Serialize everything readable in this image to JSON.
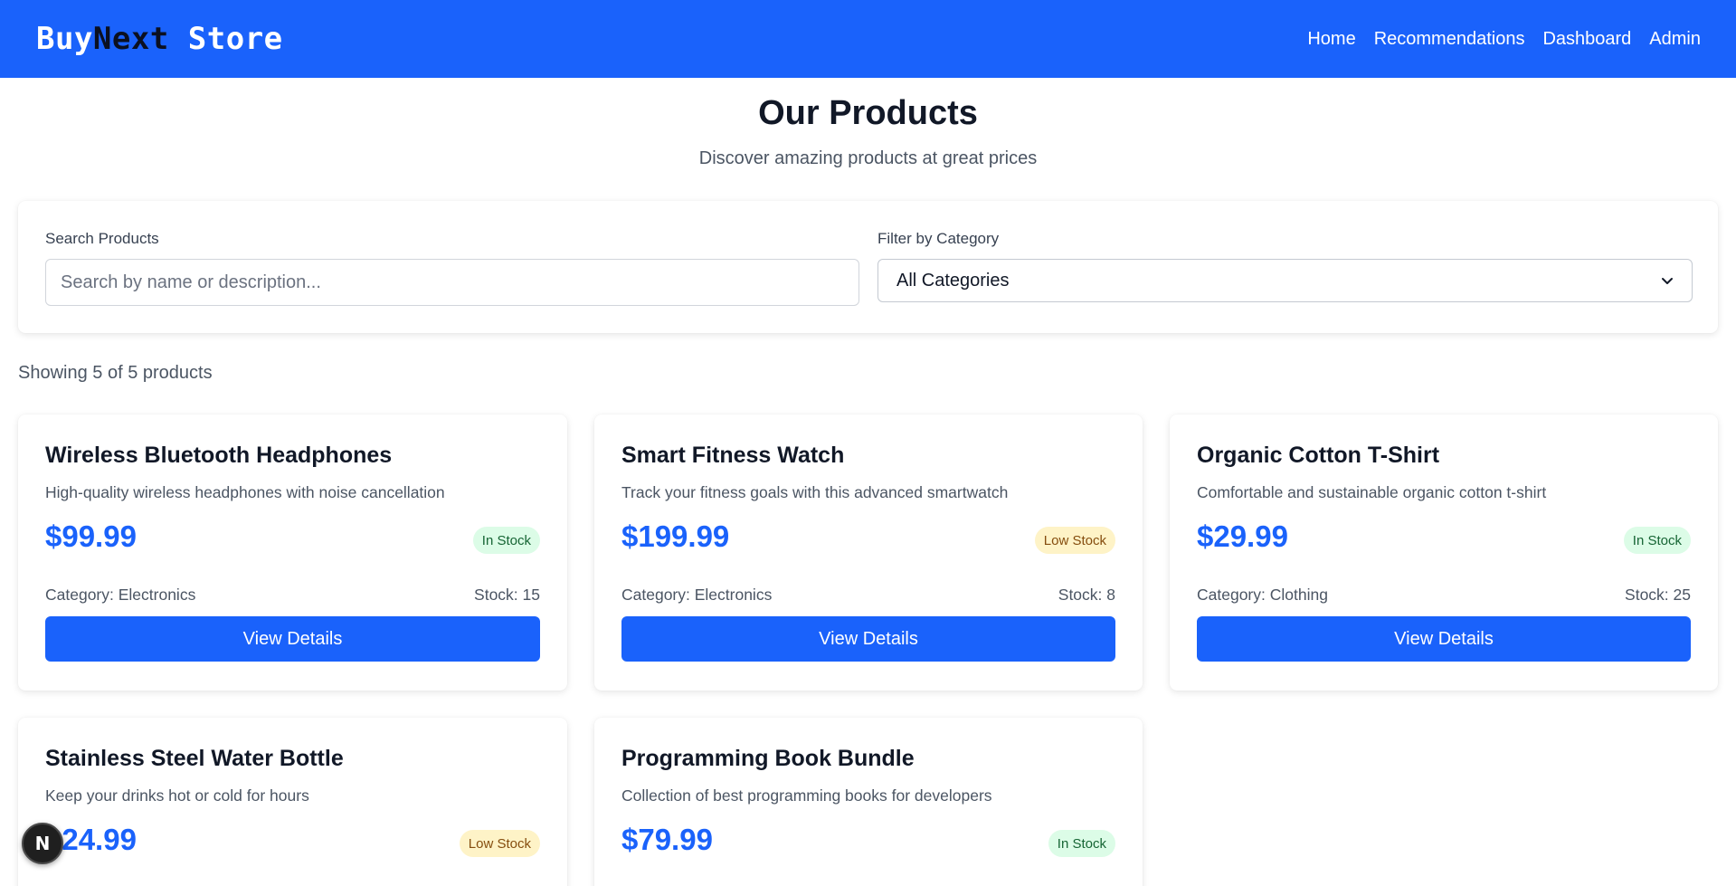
{
  "header": {
    "brand_part1": "Buy",
    "brand_part2": "Next",
    "brand_part3": " Store",
    "nav": [
      "Home",
      "Recommendations",
      "Dashboard",
      "Admin"
    ]
  },
  "page": {
    "title": "Our Products",
    "subtitle": "Discover amazing products at great prices"
  },
  "filters": {
    "search_label": "Search Products",
    "search_placeholder": "Search by name or description...",
    "search_value": "",
    "category_label": "Filter by Category",
    "category_selected": "All Categories"
  },
  "summary": "Showing 5 of 5 products",
  "products": [
    {
      "name": "Wireless Bluetooth Headphones",
      "description": "High-quality wireless headphones with noise cancellation",
      "price": "$99.99",
      "status": "In Stock",
      "category": "Category: Electronics",
      "stock": "Stock: 15",
      "button": "View Details"
    },
    {
      "name": "Smart Fitness Watch",
      "description": "Track your fitness goals with this advanced smartwatch",
      "price": "$199.99",
      "status": "Low Stock",
      "category": "Category: Electronics",
      "stock": "Stock: 8",
      "button": "View Details"
    },
    {
      "name": "Organic Cotton T-Shirt",
      "description": "Comfortable and sustainable organic cotton t-shirt",
      "price": "$29.99",
      "status": "In Stock",
      "category": "Category: Clothing",
      "stock": "Stock: 25",
      "button": "View Details"
    },
    {
      "name": "Stainless Steel Water Bottle",
      "description": "Keep your drinks hot or cold for hours",
      "price": "$24.99",
      "status": "Low Stock"
    },
    {
      "name": "Programming Book Bundle",
      "description": "Collection of best programming books for developers",
      "price": "$79.99",
      "status": "In Stock"
    }
  ],
  "dev_indicator": {
    "letter": "N"
  },
  "colors": {
    "primary": "#1a62fb",
    "in_stock_bg": "#dcfce7",
    "low_stock_bg": "#fef3c7"
  }
}
